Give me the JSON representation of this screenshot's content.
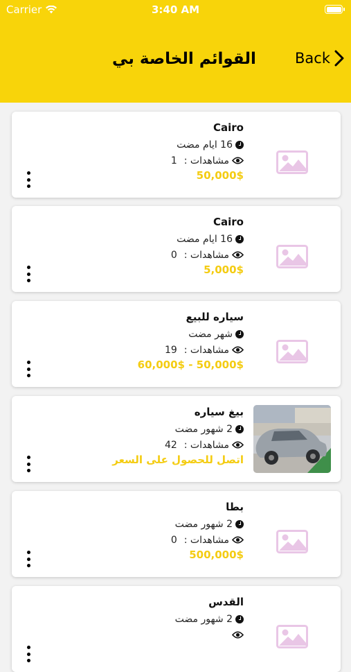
{
  "status_bar": {
    "carrier": "Carrier",
    "time": "3:40 AM"
  },
  "nav": {
    "back_label": "Back",
    "title": "القوائم الخاصة بي"
  },
  "listings": [
    {
      "name": "Cairo",
      "time_ago": "16 ايام مضت",
      "views_label": "مشاهدات :",
      "views": "1",
      "price": "50,000$",
      "image": "placeholder"
    },
    {
      "name": "Cairo",
      "time_ago": "16 ايام مضت",
      "views_label": "مشاهدات :",
      "views": "0",
      "price": "5,000$",
      "image": "placeholder"
    },
    {
      "name": "سياره للبيع",
      "time_ago": "شهر مضت",
      "views_label": "مشاهدات :",
      "views": "19",
      "price": "50,000$ - 60,000$",
      "image": "placeholder"
    },
    {
      "name": "بيغ سياره",
      "time_ago": "2 شهور مضت",
      "views_label": "مشاهدات :",
      "views": "42",
      "price": "اتصل للحصول على السعر",
      "image": "car-photo"
    },
    {
      "name": "بطا",
      "time_ago": "2 شهور مضت",
      "views_label": "مشاهدات :",
      "views": "0",
      "price": "500,000$",
      "image": "placeholder"
    },
    {
      "name": "القدس",
      "time_ago": "2 شهور مضت",
      "views_label": "",
      "views": "",
      "price": "",
      "image": "placeholder"
    }
  ],
  "colors": {
    "header": "#f8d40a",
    "price": "#f4cc12",
    "placeholder_icon": "#e9c6e6"
  }
}
